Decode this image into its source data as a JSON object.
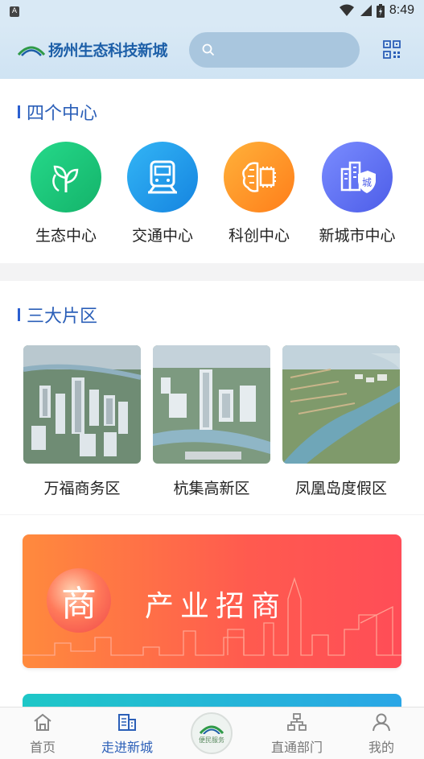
{
  "status_bar": {
    "indicator": "A",
    "time": "8:49"
  },
  "header": {
    "app_name": "扬州生态科技新城",
    "search_placeholder": ""
  },
  "four_centers": {
    "title": "四个中心",
    "items": [
      {
        "label": "生态中心",
        "icon": "plant-icon",
        "color": "#1fc07a"
      },
      {
        "label": "交通中心",
        "icon": "train-icon",
        "color": "#1e9ae8"
      },
      {
        "label": "科创中心",
        "icon": "brain-chip-icon",
        "color": "#ff9a1f"
      },
      {
        "label": "新城市中心",
        "icon": "city-shield-icon",
        "color": "#5a6ff0",
        "badge": "城"
      }
    ]
  },
  "three_zones": {
    "title": "三大片区",
    "items": [
      {
        "label": "万福商务区"
      },
      {
        "label": "杭集高新区"
      },
      {
        "label": "凤凰岛度假区"
      }
    ]
  },
  "banner": {
    "title": "产业招商",
    "badge_char": "商"
  },
  "tabbar": {
    "items": [
      {
        "label": "首页",
        "icon": "home-icon"
      },
      {
        "label": "走进新城",
        "icon": "building-icon",
        "active": true
      },
      {
        "label": "便民服务",
        "icon": "service-logo-icon"
      },
      {
        "label": "直通部门",
        "icon": "org-chart-icon"
      },
      {
        "label": "我的",
        "icon": "user-icon"
      }
    ]
  }
}
